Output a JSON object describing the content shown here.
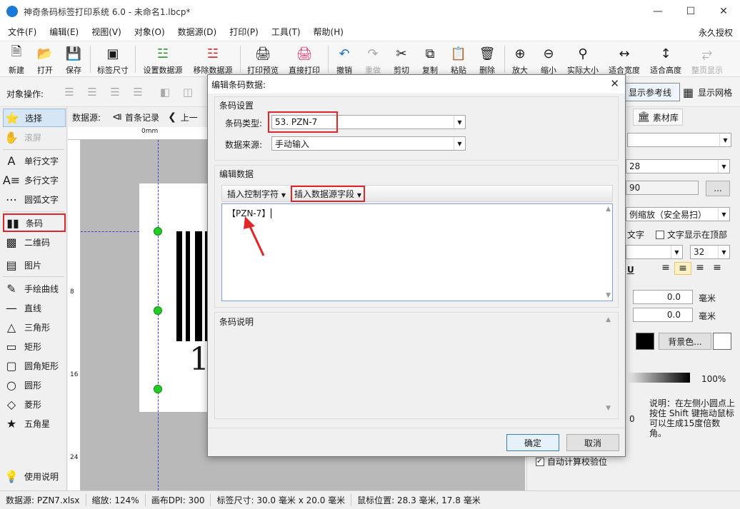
{
  "window": {
    "title": "神奇条码标签打印系统 6.0 - 未命名1.lbcp*"
  },
  "menu": {
    "items": [
      "文件(F)",
      "编辑(E)",
      "视图(V)",
      "对象(O)",
      "数据源(D)",
      "打印(P)",
      "工具(T)",
      "帮助(H)"
    ],
    "right": "永久授权"
  },
  "toolbar": {
    "buttons": [
      "新建",
      "打开",
      "保存",
      "标签尺寸",
      "设置数据源",
      "移除数据源",
      "打印预览",
      "直接打印",
      "撤销",
      "重做",
      "剪切",
      "复制",
      "粘贴",
      "删除",
      "放大",
      "缩小",
      "实际大小",
      "适合宽度",
      "适合高度",
      "整页显示"
    ]
  },
  "opsbar": {
    "label": "对象操作:",
    "show_ref": "显示参考线",
    "show_grid": "显示网格"
  },
  "left_tools": [
    "选择",
    "滚屏",
    "单行文字",
    "多行文字",
    "圆弧文字",
    "条码",
    "二维码",
    "图片",
    "手绘曲线",
    "直线",
    "三角形",
    "矩形",
    "圆角矩形",
    "圆形",
    "菱形",
    "五角星",
    "使用说明"
  ],
  "datasource_bar": {
    "label": "数据源:",
    "first": "首条记录",
    "prev": "上一"
  },
  "ruler": {
    "h_zero": "0mm",
    "h_8": "8",
    "v_8": "8",
    "v_16": "16",
    "v_24": "24"
  },
  "canvas": {
    "barcode_digit": "1"
  },
  "right_panel": {
    "tab_library": "素材库",
    "value_28": "28",
    "value_90": "90",
    "more": "...",
    "scale_option": "例缩放（安全易扫）",
    "text_label": "文字",
    "text_top": "文字显示在顶部",
    "font_size": "32",
    "offset_x": "0.0",
    "offset_y": "0.0",
    "unit1": "毫米",
    "unit2": "毫米",
    "bg_color": "背景色...",
    "opacity": "100%",
    "zero": "0",
    "hint": "说明：在左侧小圆点上按住 Shift 键拖动鼠标可以生成15度倍数角。",
    "auto_check": "自动计算校验位"
  },
  "dialog": {
    "title": "编辑条码数据:",
    "barcode_settings": "条码设置",
    "barcode_type_label": "条码类型:",
    "barcode_type_value": "53. PZN-7",
    "datasource_label": "数据来源:",
    "datasource_value": "手动输入",
    "edit_data": "编辑数据",
    "insert_ctrl": "插入控制字符",
    "insert_field": "插入数据源字段",
    "editor_content": "【PZN-7】",
    "barcode_desc": "条码说明",
    "ok": "确定",
    "cancel": "取消"
  },
  "status": {
    "datasource": "数据源: PZN7.xlsx",
    "zoom": "缩放: 124%",
    "dpi": "画布DPI: 300",
    "size": "标签尺寸: 30.0 毫米 x 20.0 毫米",
    "mouse": "鼠标位置: 28.3 毫米, 17.8 毫米"
  },
  "colors": {
    "accent": "#1e78d7",
    "highlight": "#e0262b",
    "handle": "#22cc22",
    "guide": "#3b3bd8"
  }
}
